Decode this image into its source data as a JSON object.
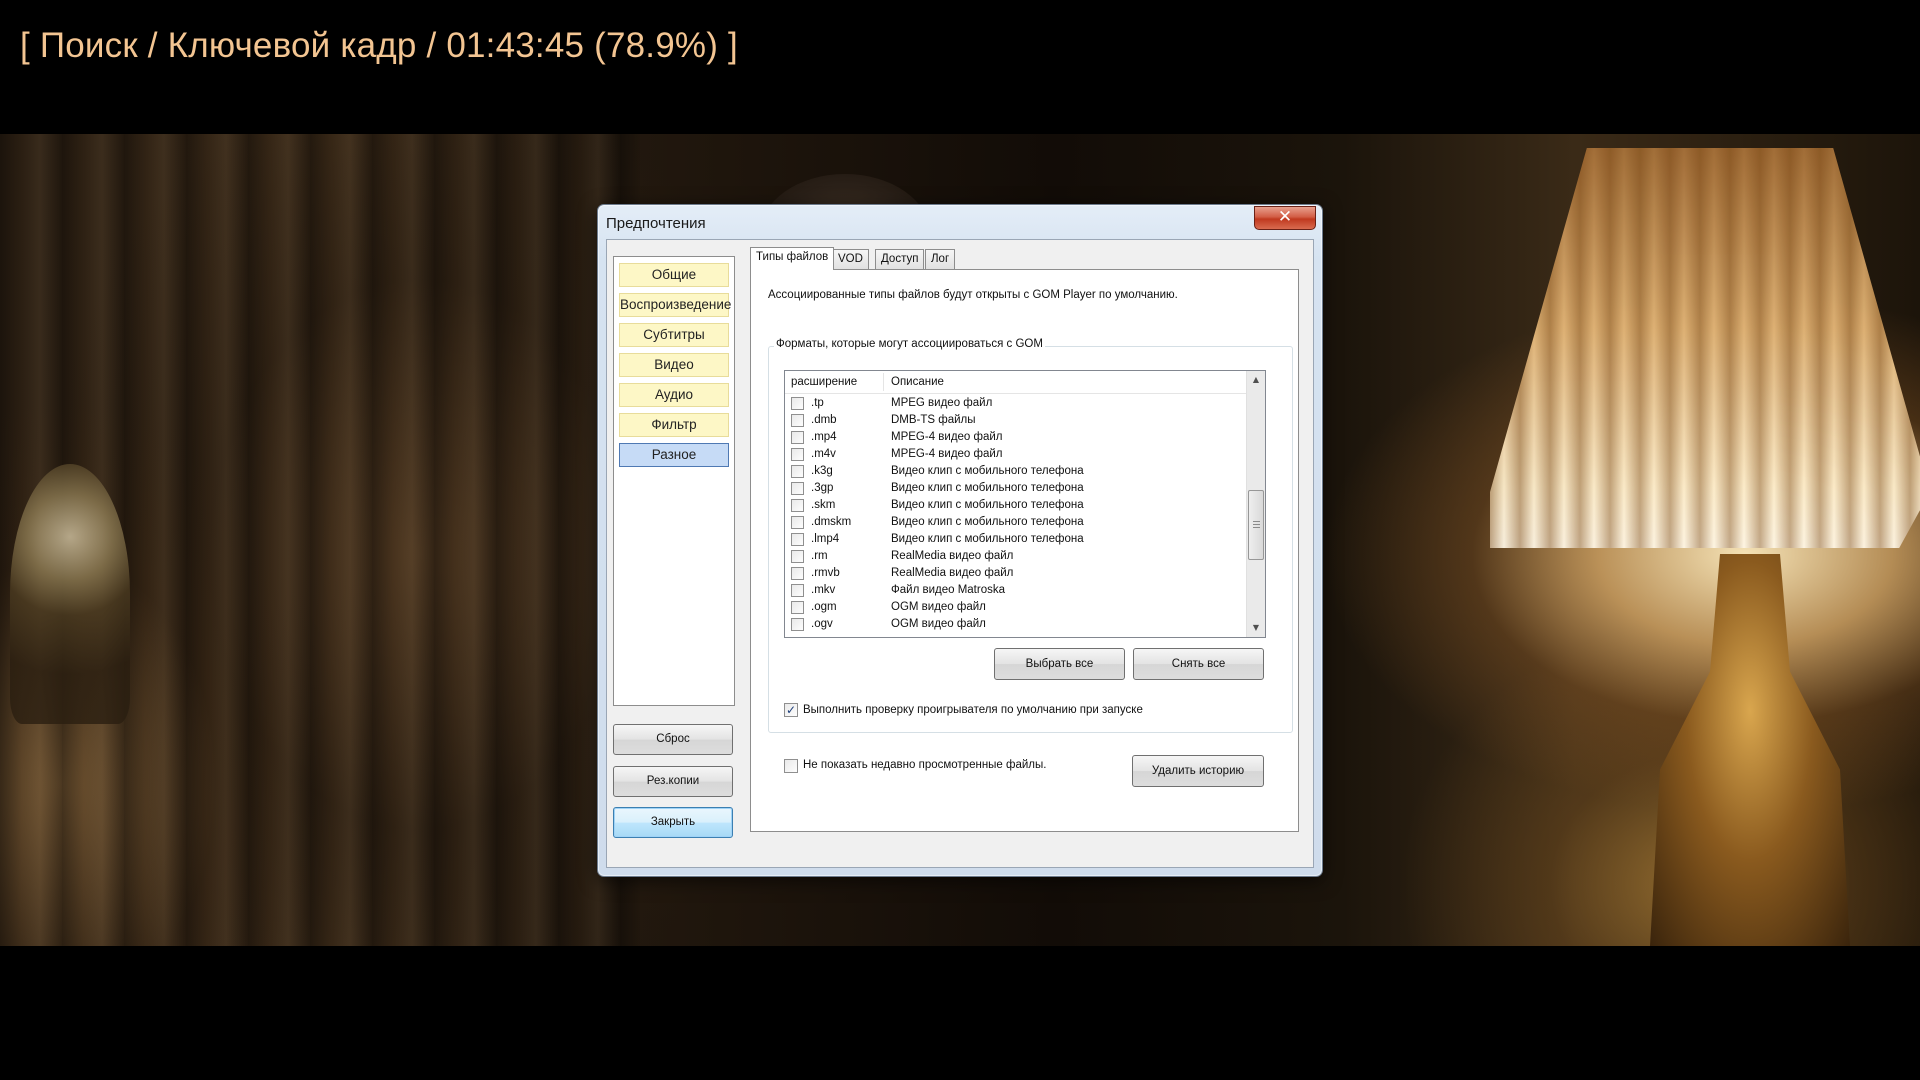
{
  "osd": {
    "text": "[ Поиск / Ключевой кадр / 01:43:45 (78.9%) ]"
  },
  "dialog": {
    "title": "Предпочтения",
    "close_glyph": "✕",
    "nav": [
      {
        "label": "Общие"
      },
      {
        "label": "Воспроизведение"
      },
      {
        "label": "Субтитры"
      },
      {
        "label": "Видео"
      },
      {
        "label": "Аудио"
      },
      {
        "label": "Фильтр"
      },
      {
        "label": "Разное"
      }
    ],
    "active_nav": "Разное",
    "side_buttons": {
      "reset": "Сброс",
      "backup": "Рез.копии",
      "close": "Закрыть"
    },
    "tabs": [
      {
        "label": "Типы файлов"
      },
      {
        "label": "VOD"
      },
      {
        "label": "Доступ"
      },
      {
        "label": "Лог"
      }
    ],
    "file_types": {
      "info": "Ассоциированные типы файлов будут открыты с GOM Player по умолчанию.",
      "group_label": "Форматы, которые могут ассоциироваться с GOM",
      "columns": {
        "ext": "расширение",
        "desc": "Описание"
      },
      "rows": [
        {
          "ext": ".tp",
          "desc": "MPEG видео файл"
        },
        {
          "ext": ".dmb",
          "desc": "DMB-TS файлы"
        },
        {
          "ext": ".mp4",
          "desc": "MPEG-4 видео файл"
        },
        {
          "ext": ".m4v",
          "desc": "MPEG-4 видео файл"
        },
        {
          "ext": ".k3g",
          "desc": "Видео клип с мобильного телефона"
        },
        {
          "ext": ".3gp",
          "desc": "Видео клип с мобильного телефона"
        },
        {
          "ext": ".skm",
          "desc": "Видео клип с мобильного телефона"
        },
        {
          "ext": ".dmskm",
          "desc": "Видео клип с мобильного телефона"
        },
        {
          "ext": ".lmp4",
          "desc": "Видео клип с мобильного телефона"
        },
        {
          "ext": ".rm",
          "desc": "RealMedia видео файл"
        },
        {
          "ext": ".rmvb",
          "desc": "RealMedia видео файл"
        },
        {
          "ext": ".mkv",
          "desc": "Файл видео Matroska"
        },
        {
          "ext": ".ogm",
          "desc": "OGM видео файл"
        },
        {
          "ext": ".ogv",
          "desc": "OGM видео файл"
        }
      ],
      "select_all": "Выбрать все",
      "deselect_all": "Снять все",
      "check_default": {
        "label": "Выполнить проверку проигрывателя по умолчанию при запуске",
        "checked": true
      },
      "hide_recent": {
        "label": "Не показать недавно просмотренные файлы.",
        "checked": false
      },
      "delete_history": "Удалить историю"
    }
  },
  "colors": {
    "osd_text": "#f3c592",
    "nav_item_bg": "#fdf7c6",
    "nav_active_bg": "#c6dbf6",
    "close_button": "#c0391f"
  }
}
